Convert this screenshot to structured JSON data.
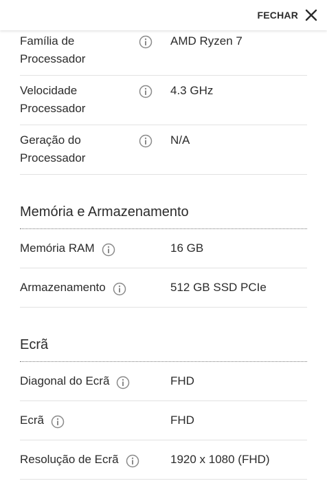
{
  "header": {
    "close_label": "FECHAR"
  },
  "processor": {
    "rows": [
      {
        "label_line1": "Família de",
        "label_line2": "Processador",
        "value": "AMD Ryzen 7"
      },
      {
        "label_line1": "Velocidade",
        "label_line2": "Processador",
        "value": "4.3 GHz"
      },
      {
        "label_line1": "Geração do",
        "label_line2": "Processador",
        "value": "N/A"
      }
    ]
  },
  "memory": {
    "title": "Memória e Armazenamento",
    "rows": [
      {
        "label": "Memória RAM",
        "value": "16 GB"
      },
      {
        "label": "Armazenamento",
        "value": "512 GB SSD PCIe"
      }
    ]
  },
  "screen": {
    "title": "Ecrã",
    "rows": [
      {
        "label": "Diagonal do Ecrã",
        "value": "FHD"
      },
      {
        "label": "Ecrã",
        "value": "FHD"
      },
      {
        "label": "Resolução de Ecrã",
        "value": "1920 x 1080 (FHD)"
      }
    ]
  },
  "colors": {
    "text": "#2b2b2b",
    "divider": "#e2e2e2",
    "icon": "#8a8a8a"
  },
  "icons": {
    "info": "info-circle-icon",
    "close": "close-x-icon"
  }
}
